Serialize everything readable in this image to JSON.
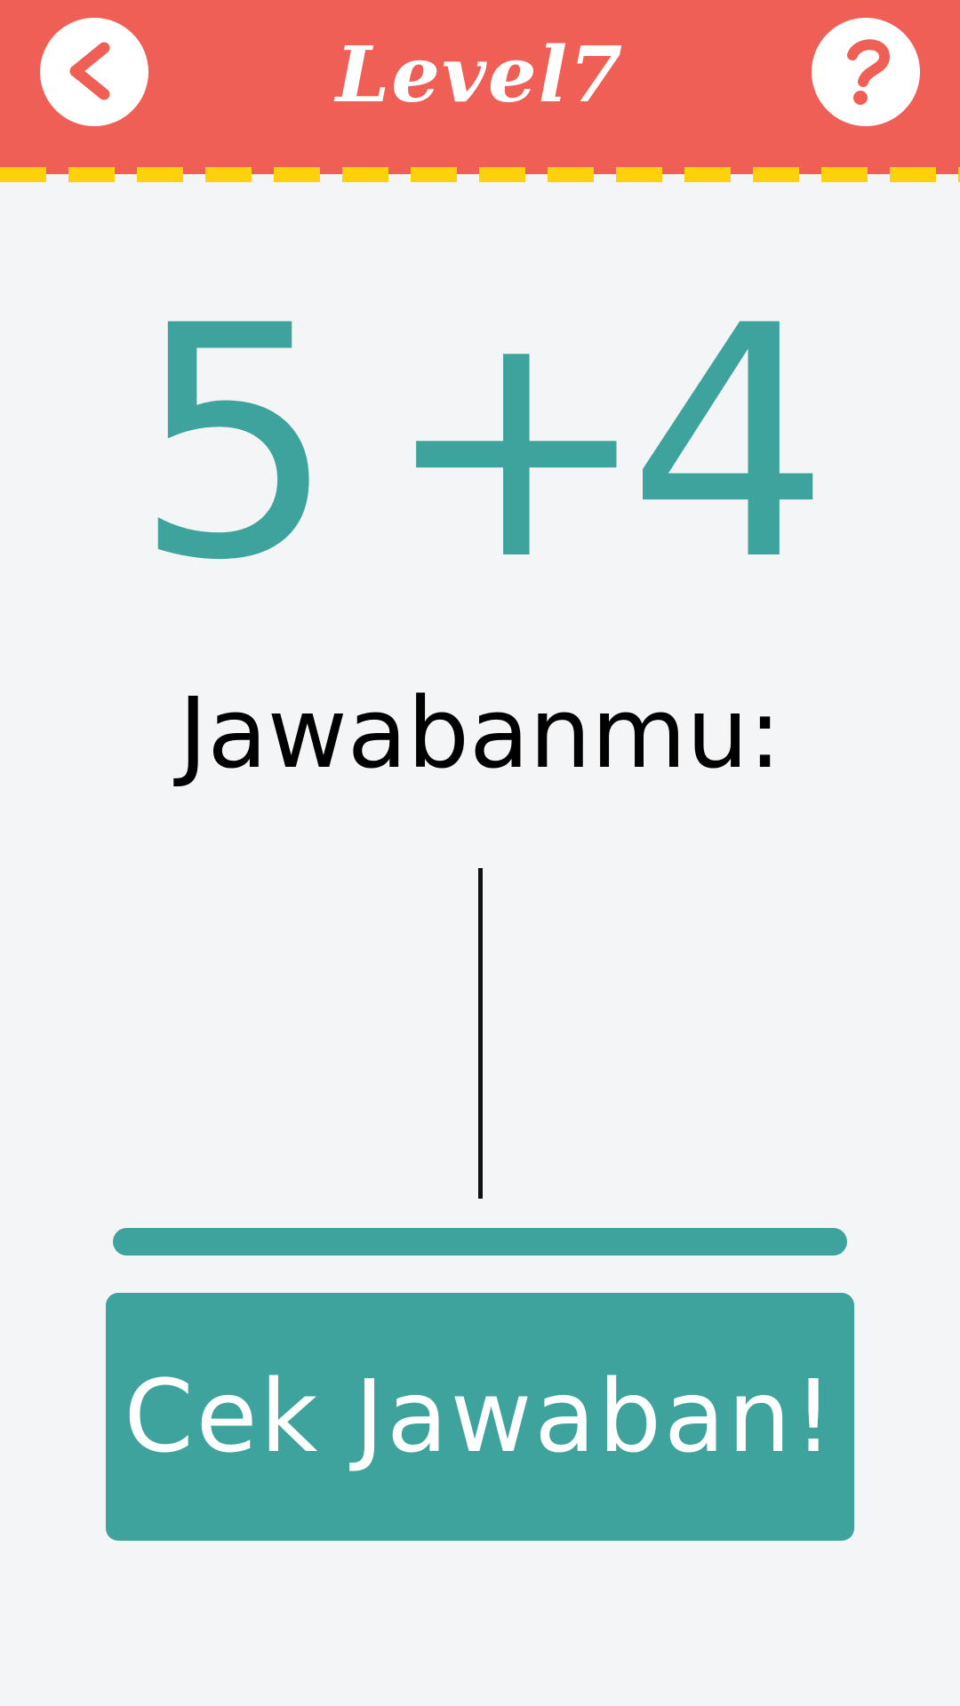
{
  "colors": {
    "header_bg": "#f05f55",
    "dash": "#ffd10d",
    "accent": "#3fa39d",
    "background": "#f3f5f7"
  },
  "header": {
    "title": "Level7",
    "back_icon": "chevron-left-icon",
    "help_icon": "question-mark-icon"
  },
  "equation": {
    "operand_a": "5",
    "operator": "+",
    "operand_b": "4"
  },
  "prompt": "Jawabanmu:",
  "answer": {
    "value": ""
  },
  "check_button": {
    "label": "Cek Jawaban!"
  }
}
